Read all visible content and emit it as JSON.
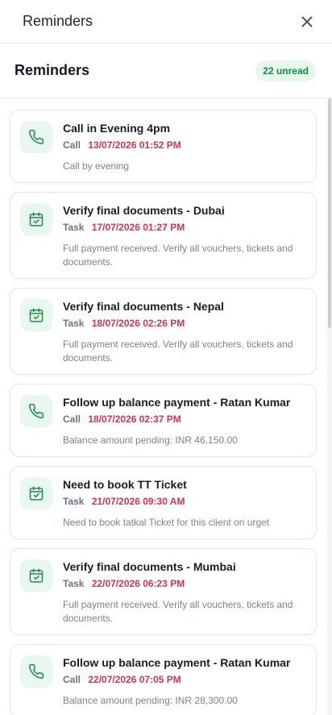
{
  "header": {
    "title": "Reminders",
    "close_icon": "close-icon"
  },
  "subheader": {
    "title": "Reminders",
    "unread_badge": "22 unread"
  },
  "colors": {
    "accent_green": "#178a43",
    "badge_bg": "#e6f7ec",
    "date_red": "#d1344c",
    "icon_bg": "#e9f8ef"
  },
  "reminders": [
    {
      "icon": "phone-icon",
      "title": "Call in Evening 4pm",
      "type": "Call",
      "date": "13/07/2026 01:52 PM",
      "description": "Call by evening"
    },
    {
      "icon": "calendar-check-icon",
      "title": "Verify final documents - Dubai",
      "type": "Task",
      "date": "17/07/2026 01:27 PM",
      "description": "Full payment received. Verify all vouchers, tickets and documents."
    },
    {
      "icon": "calendar-check-icon",
      "title": "Verify final documents - Nepal",
      "type": "Task",
      "date": "18/07/2026 02:26 PM",
      "description": "Full payment received. Verify all vouchers, tickets and documents."
    },
    {
      "icon": "phone-icon",
      "title": "Follow up balance payment - Ratan Kumar",
      "type": "Call",
      "date": "18/07/2026 02:37 PM",
      "description": "Balance amount pending: INR 46,150.00"
    },
    {
      "icon": "calendar-check-icon",
      "title": "Need to book TT Ticket",
      "type": "Task",
      "date": "21/07/2026 09:30 AM",
      "description": "Need to book tatkal Ticket for this client on urget"
    },
    {
      "icon": "calendar-check-icon",
      "title": "Verify final documents - Mumbai",
      "type": "Task",
      "date": "22/07/2026 06:23 PM",
      "description": "Full payment received. Verify all vouchers, tickets and documents."
    },
    {
      "icon": "phone-icon",
      "title": "Follow up balance payment - Ratan Kumar",
      "type": "Call",
      "date": "22/07/2026 07:05 PM",
      "description": "Balance amount pending: INR 28,300.00"
    }
  ]
}
